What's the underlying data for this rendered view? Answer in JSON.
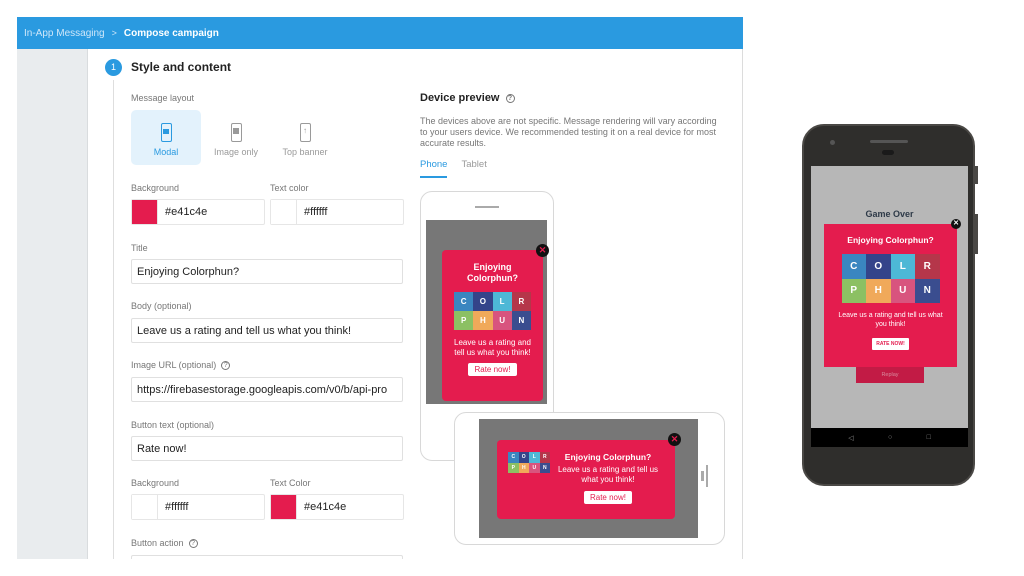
{
  "breadcrumb": {
    "root": "In-App Messaging",
    "separator": ">",
    "current": "Compose campaign"
  },
  "step": {
    "number": "1",
    "title": "Style and content"
  },
  "message_layout": {
    "label": "Message layout",
    "options": [
      {
        "label": "Modal",
        "icon": "modal-layout-icon",
        "selected": true
      },
      {
        "label": "Image only",
        "icon": "image-only-layout-icon",
        "selected": false
      },
      {
        "label": "Top banner",
        "icon": "top-banner-layout-icon",
        "selected": false
      }
    ]
  },
  "style": {
    "background_label": "Background",
    "background_value": "#e41c4e",
    "text_color_label": "Text color",
    "text_color_value": "#ffffff"
  },
  "title_field": {
    "label": "Title",
    "value": "Enjoying Colorphun?"
  },
  "body_field": {
    "label": "Body (optional)",
    "value": "Leave us a rating and tell us what you think!"
  },
  "image_url_field": {
    "label": "Image URL (optional)",
    "value": "https://firebasestorage.googleapis.com/v0/b/api-pro"
  },
  "button_text_field": {
    "label": "Button text (optional)",
    "value": "Rate now!"
  },
  "button_style": {
    "background_label": "Background",
    "background_value": "#ffffff",
    "text_color_label": "Text Color",
    "text_color_value": "#e41c4e"
  },
  "button_action": {
    "label": "Button action"
  },
  "device_preview": {
    "title": "Device preview",
    "description": "The devices above are not specific. Message rendering will vary according to your users device. We recommended testing it on a real device for most accurate results.",
    "tabs": [
      {
        "label": "Phone",
        "active": true
      },
      {
        "label": "Tablet",
        "active": false
      }
    ]
  },
  "preview_message": {
    "title": "Enjoying Colorphun?",
    "body": "Leave us a rating and tell us what you think!",
    "button": "Rate now!",
    "logo_letters": [
      "C",
      "O",
      "L",
      "R",
      "P",
      "H",
      "U",
      "N"
    ],
    "logo_colors": [
      "#3a86c0",
      "#34448a",
      "#4db8d6",
      "#b5364a",
      "#8cc063",
      "#f0a95a",
      "#d8547e",
      "#3a4d8f"
    ]
  },
  "real_device": {
    "screen_title": "Game Over",
    "message_title": "Enjoying Colorphun?",
    "message_body": "Leave us a rating and tell us what you think!",
    "button": "RATE NOW!",
    "replay": "Replay",
    "nav": [
      "◁",
      "○",
      "□"
    ]
  },
  "colors": {
    "brand_blue": "#2a9ae0",
    "message_bg": "#e41c4e"
  }
}
